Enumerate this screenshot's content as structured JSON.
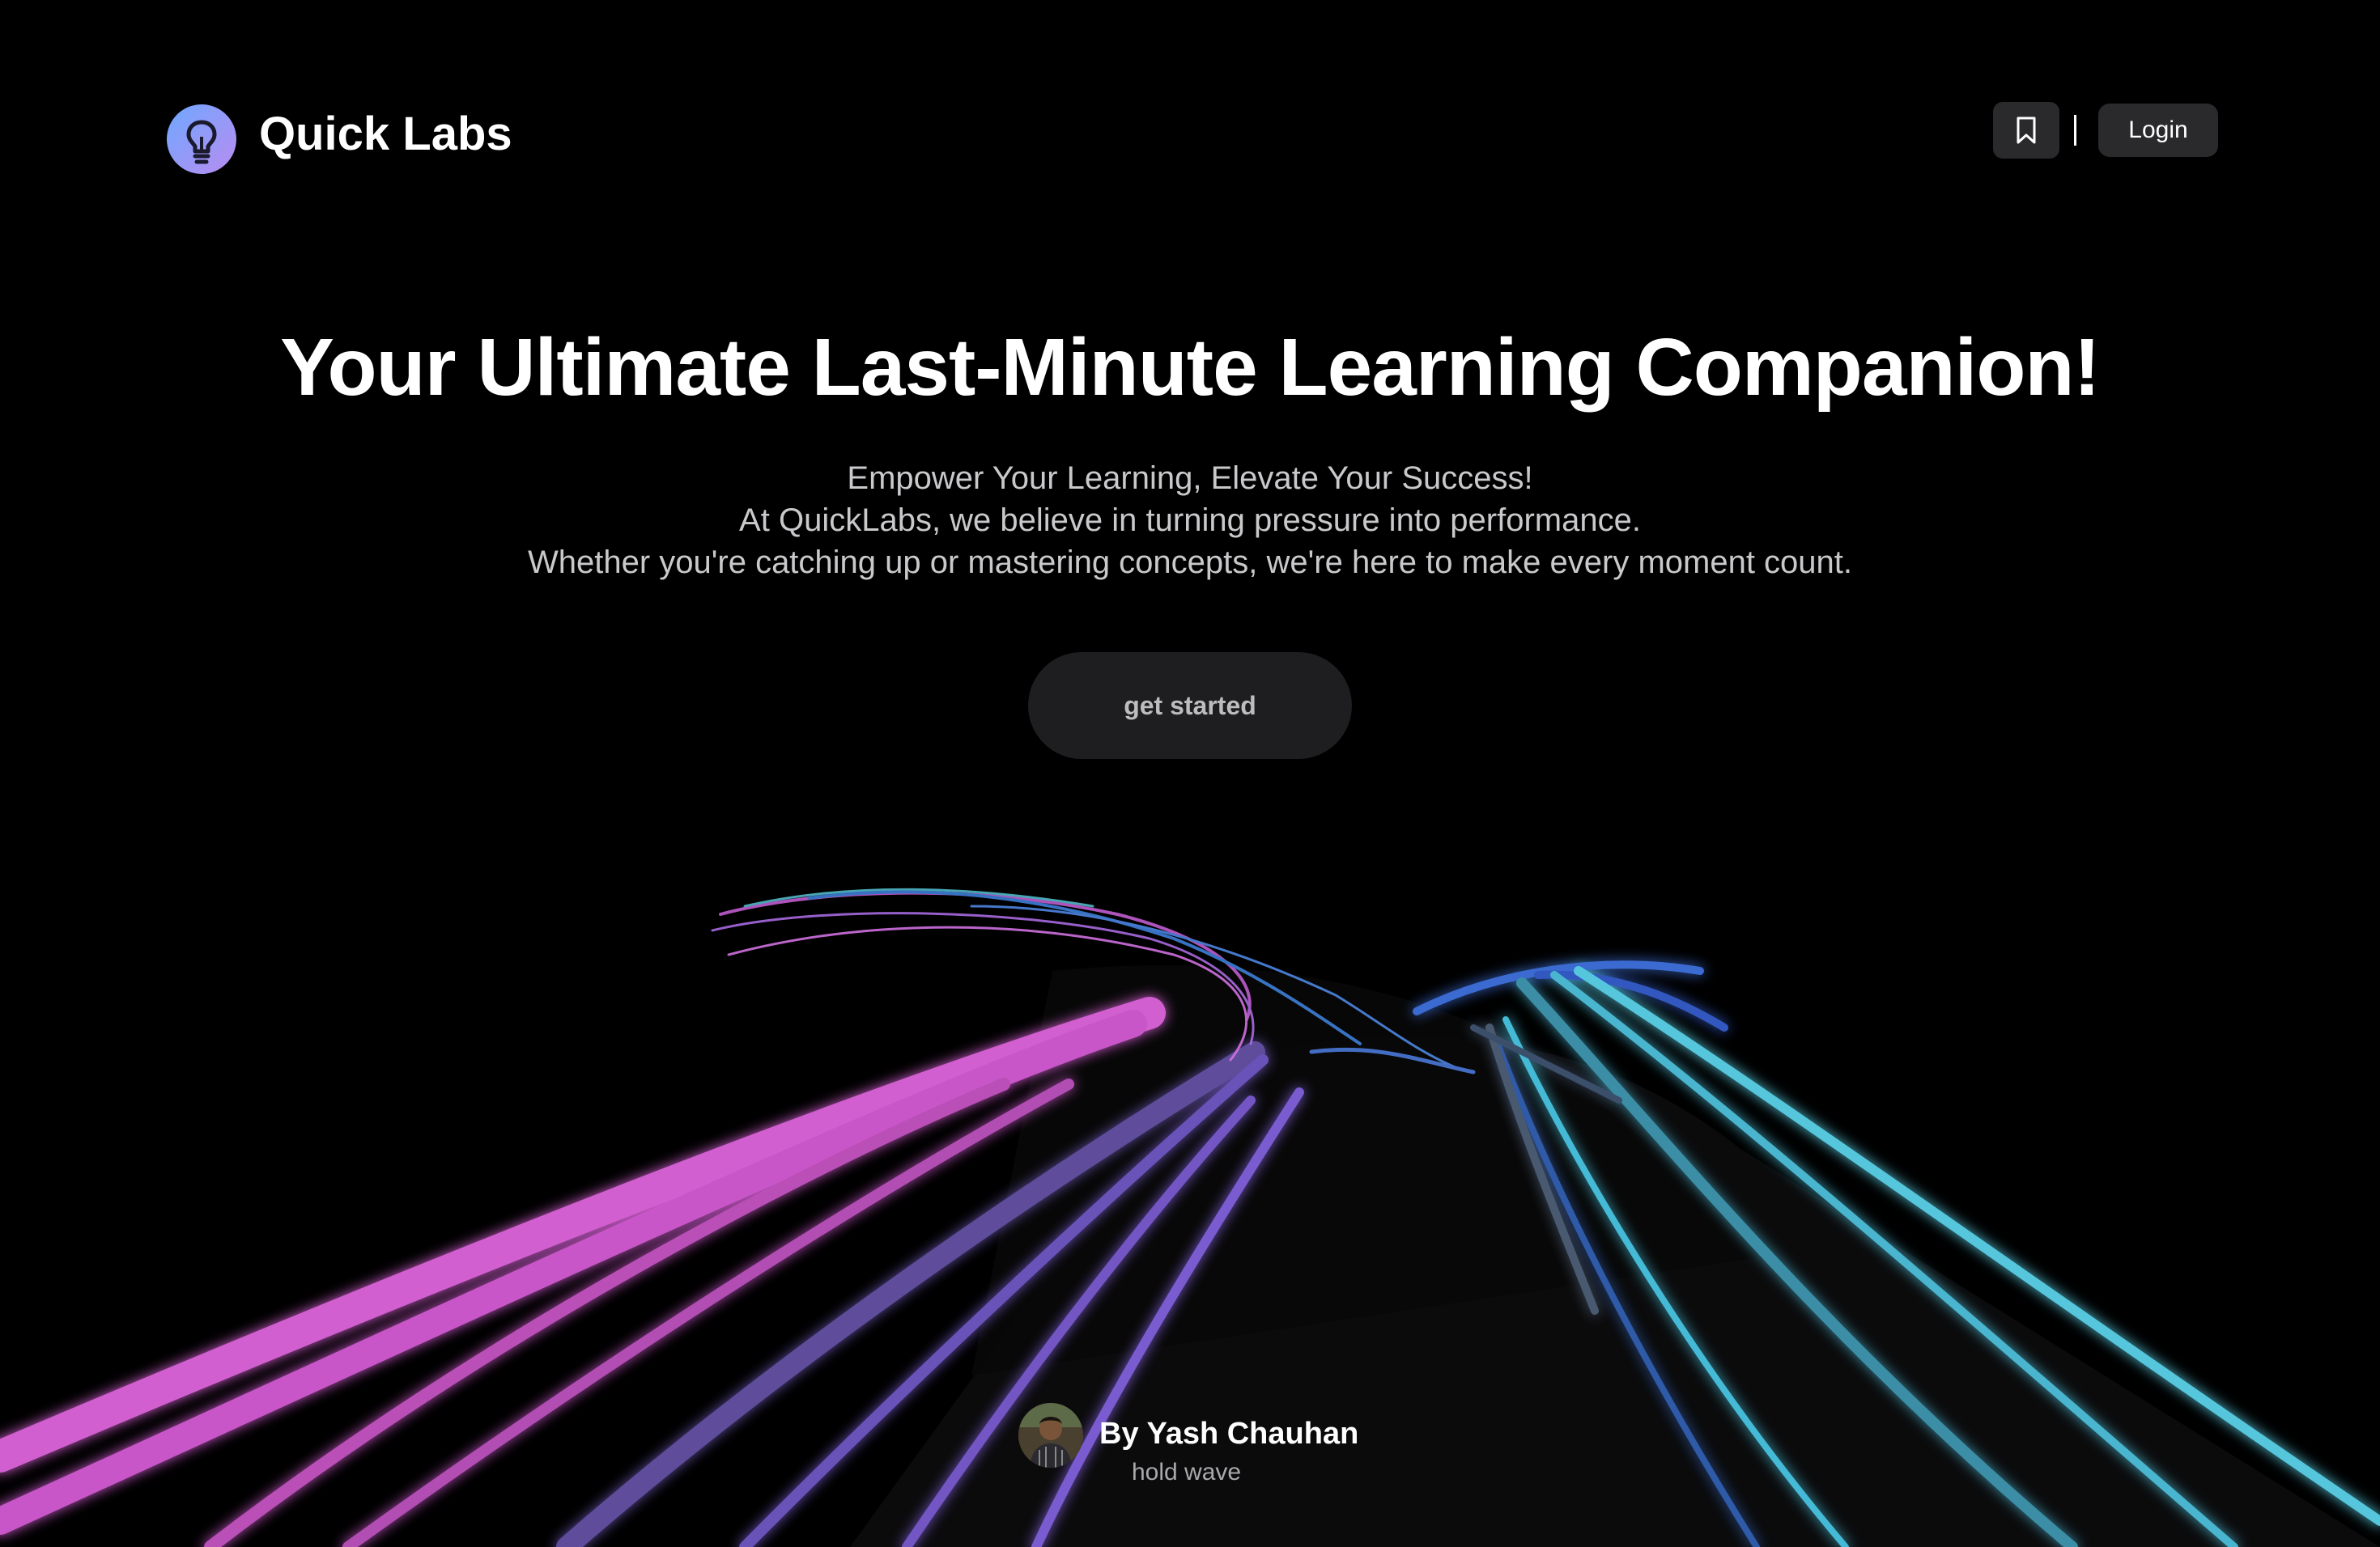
{
  "header": {
    "brand_name": "Quick Labs",
    "logo_icon": "lightbulb-icon",
    "bookmark_icon": "bookmark-icon",
    "login_label": "Login"
  },
  "hero": {
    "title": "Your Ultimate Last-Minute Learning Companion!",
    "subtitle_lines": [
      "Empower Your Learning, Elevate Your Success!",
      "At QuickLabs, we believe in turning pressure into performance.",
      "Whether you're catching up or mastering concepts, we're here to make every moment count."
    ],
    "cta_label": "get started"
  },
  "credit": {
    "name": "By Yash Chauhan",
    "subtitle": "hold wave"
  },
  "colors": {
    "background": "#000000",
    "button_bg": "#2a2a2c",
    "cta_bg": "#1e1e20",
    "wave_pink": "#e060d0",
    "wave_purple": "#7a5ad0",
    "wave_cyan": "#4fc8e0",
    "wave_blue": "#3a6ad0"
  }
}
